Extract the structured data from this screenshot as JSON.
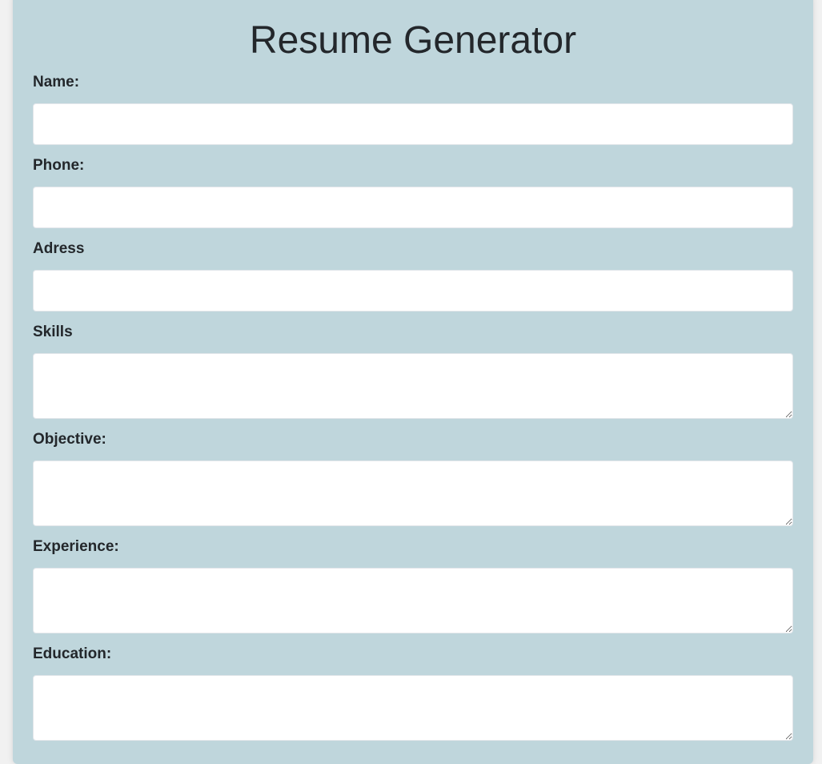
{
  "form": {
    "title": "Resume Generator",
    "fields": {
      "name": {
        "label": "Name:",
        "value": ""
      },
      "phone": {
        "label": "Phone:",
        "value": ""
      },
      "address": {
        "label": "Adress",
        "value": ""
      },
      "skills": {
        "label": "Skills",
        "value": ""
      },
      "objective": {
        "label": "Objective:",
        "value": ""
      },
      "experience": {
        "label": "Experience:",
        "value": ""
      },
      "education": {
        "label": "Education:",
        "value": ""
      }
    }
  }
}
